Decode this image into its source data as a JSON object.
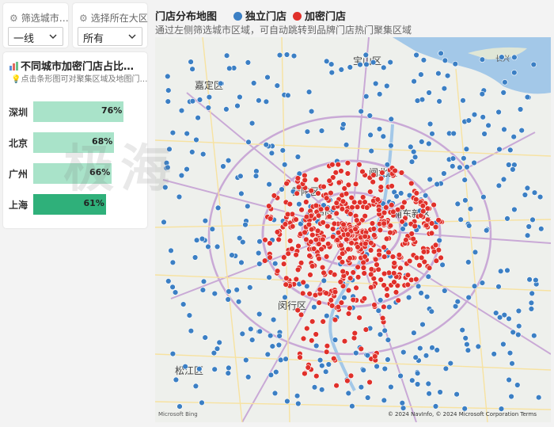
{
  "filters": {
    "city": {
      "title": "筛选城市…",
      "value": "一线"
    },
    "region": {
      "title": "选择所在大区",
      "value": "所有"
    }
  },
  "bar_panel": {
    "title": "不同城市加密门店占比…",
    "subtitle": "点击条形图可对聚集区域及地图门…",
    "icon": "bar-chart-icon"
  },
  "chart_data": {
    "type": "bar",
    "categories": [
      "深圳",
      "北京",
      "广州",
      "上海"
    ],
    "values": [
      76,
      68,
      66,
      61
    ],
    "value_labels": [
      "76%",
      "68%",
      "66%",
      "61%"
    ],
    "colors": [
      "#a9e3c9",
      "#a9e3c9",
      "#a9e3c9",
      "#2fb07a"
    ],
    "xlim": [
      0,
      100
    ]
  },
  "map_panel": {
    "title": "门店分布地图",
    "subtitle": "通过左侧筛选城市区域，可自动跳转到品牌门店热门聚集区域",
    "legend": [
      {
        "label": "独立门店",
        "color": "#3b7fc4"
      },
      {
        "label": "加密门店",
        "color": "#e0302a"
      }
    ],
    "places": [
      "宝山区",
      "嘉定区",
      "闸北区",
      "普陀区",
      "长宁区",
      "浦东新区",
      "闵行区",
      "松江区",
      "长兴"
    ],
    "attribution": "© 2024 NavInfo, © 2024 Microsoft Corporation  Terms",
    "provider": "Microsoft Bing"
  },
  "watermark": "极海"
}
